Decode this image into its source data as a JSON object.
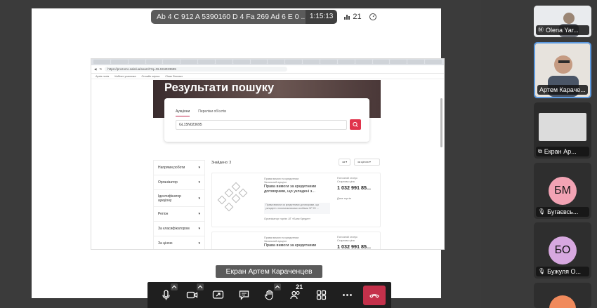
{
  "meeting": {
    "title": "Ab 4 C 912 A 5390160 D 4 Fa 269 Ad 6 E 0 ...",
    "timer": "1:15:13",
    "participants_count": "21",
    "screen_label": "Екран Артем Караченцев",
    "people_badge": "21"
  },
  "browser": {
    "url": "https://prozorro.sale/ua/search?q=GL15N023695",
    "bookmarks": [
      "Архів лотів",
      "Кабінет учасника",
      "Онлайн оцінка",
      "Clean Browser"
    ]
  },
  "page": {
    "hero_title": "Результати пошуку",
    "tabs": [
      "Аукціони",
      "Переліки об'єктів"
    ],
    "search_value": "GL15N023695",
    "found_label": "Знайдено: 3",
    "sort_label": "за",
    "sort2_label": "за ціною",
    "filters": [
      "Напрями роботи",
      "Організатор",
      "Ідентифікатор аукціону",
      "Регіон",
      "За класифікатором",
      "За ціною"
    ],
    "lots": [
      {
        "meta1": "Права вимоги та кредитним",
        "meta2": "Загальний аукціон",
        "title": "Права вимоги за кредитними договорами, що укладені з...",
        "desc": "Права вимоги за кредитними договорами, що укладені з позичальниками особами ЧР 20 ...",
        "org": "Організатор торгів: АТ «Банк Кредит»",
        "side_label": "Поточний статус",
        "side_sub": "Стартова ціна",
        "price": "1 032 991 85...",
        "side_note": "Дата торгів"
      },
      {
        "meta1": "Права вимоги та кредитним",
        "meta2": "Загальний аукціон",
        "title": "Права вимоги за кредитними договорами",
        "desc": "",
        "org": "",
        "side_label": "Поточний статус",
        "side_sub": "Стартова ціна",
        "price": "1 032 991 85...",
        "side_note": ""
      }
    ]
  },
  "participants": [
    {
      "name": "Olena Yar...",
      "initials": "",
      "type": "video"
    },
    {
      "name": "Артем Караче...",
      "initials": "",
      "type": "video"
    },
    {
      "name": "Екран Ар...",
      "initials": "",
      "type": "screen"
    },
    {
      "name": "Бугаєвсь...",
      "initials": "БМ",
      "type": "avatar",
      "color": "#f2a3b4"
    },
    {
      "name": "Бужуля О...",
      "initials": "БО",
      "type": "avatar",
      "color": "#d7a8e0"
    }
  ],
  "colors": {
    "accent": "#e0344c",
    "hangup": "#c4314b",
    "dark": "#3b3b3b"
  }
}
